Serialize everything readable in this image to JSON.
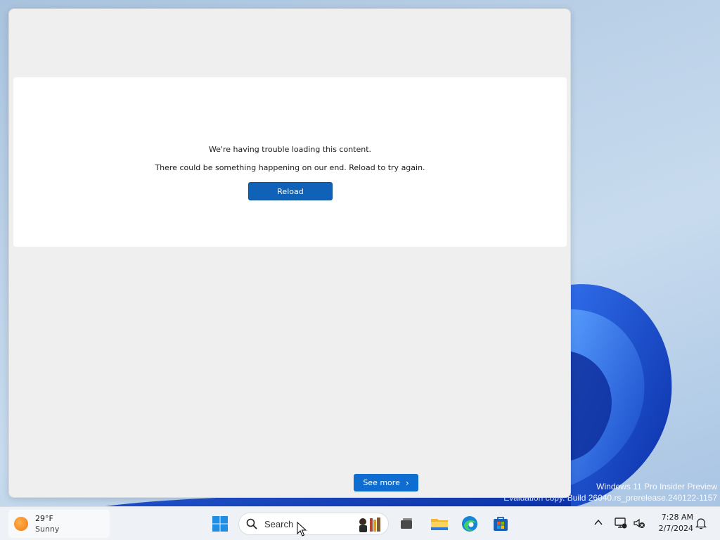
{
  "widgets": {
    "error_title": "We're having trouble loading this content.",
    "error_description": "There could be something happening on our end. Reload to try again.",
    "reload_label": "Reload",
    "see_more_label": "See more"
  },
  "watermark": {
    "line1": "Windows 11 Pro Insider Preview",
    "line2": "Evaluation copy. Build 26040.rs_prerelease.240122-1157"
  },
  "taskbar": {
    "weather": {
      "temperature": "29°F",
      "condition": "Sunny",
      "icon": "sun-icon"
    },
    "search_placeholder": "Search",
    "pinned": [
      "start-icon",
      "task-view-icon",
      "file-explorer-icon",
      "edge-icon",
      "store-icon"
    ],
    "clock": {
      "time": "7:28 AM",
      "date": "2/7/2024"
    }
  },
  "colors": {
    "accent_button": "#0f62b8",
    "panel_bg": "#efeff0",
    "card_bg": "#ffffff",
    "taskbar_bg": "#eef2f7"
  }
}
